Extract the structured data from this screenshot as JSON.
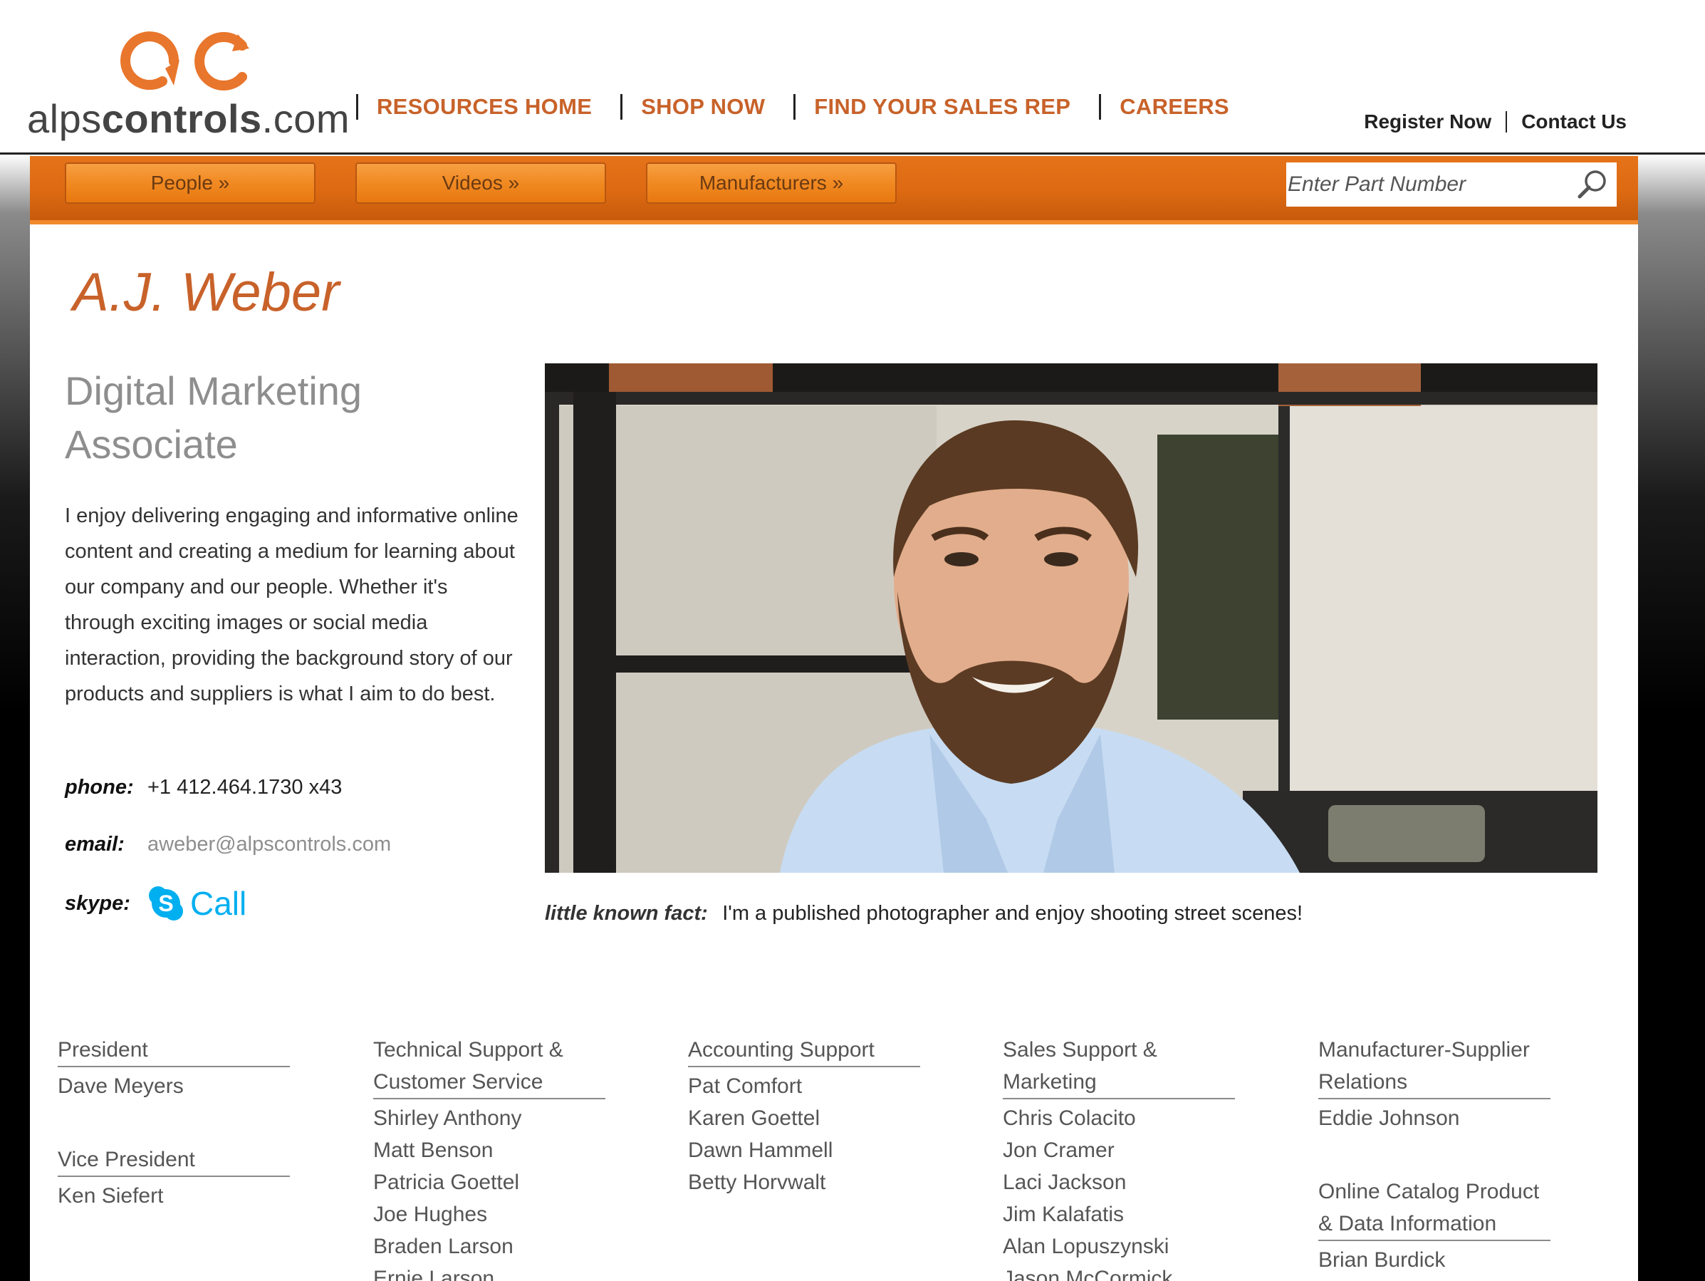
{
  "logo": {
    "text_light": "alps",
    "text_bold": "controls",
    "text_tail": ".com",
    "accent_color": "#e8762c"
  },
  "top_nav": [
    "RESOURCES HOME",
    "SHOP NOW",
    "FIND YOUR SALES REP",
    "CAREERS"
  ],
  "util_nav": {
    "register": "Register Now",
    "contact": "Contact Us"
  },
  "sub_nav": [
    "People »",
    "Videos »",
    "Manufacturers »"
  ],
  "search": {
    "placeholder": "Enter Part Number",
    "icon": "magnifier-icon"
  },
  "profile": {
    "name": "A.J. Weber",
    "title": "Digital Marketing Associate",
    "bio": "I enjoy delivering engaging and informative online content and creating a medium for learning about our company and our people. Whether it's through exciting images or social media interaction, providing the background story of our products and suppliers is what I aim to do best.",
    "phone_label": "phone:",
    "phone": "+1 412.464.1730 x43",
    "email_label": "email:",
    "email": "aweber@alpscontrols.com",
    "skype_label": "skype:",
    "skype_call": "Call",
    "fact_label": "little known fact:",
    "fact": "I'm a published photographer and enjoy shooting street scenes!"
  },
  "colors": {
    "accent": "#c8622a",
    "nav_orange": "#e8780f",
    "skype_blue": "#00aff0"
  },
  "directory": [
    [
      {
        "heading": "President",
        "members": [
          "Dave Meyers"
        ]
      },
      {
        "heading": "Vice President",
        "members": [
          "Ken Siefert"
        ]
      }
    ],
    [
      {
        "heading": "Technical Support & Customer Service",
        "members": [
          "Shirley Anthony",
          "Matt Benson",
          "Patricia Goettel",
          "Joe Hughes",
          "Braden Larson",
          "Ernie Larson"
        ]
      }
    ],
    [
      {
        "heading": "Accounting Support",
        "members": [
          "Pat Comfort",
          "Karen Goettel",
          "Dawn Hammell",
          "Betty Horvwalt"
        ]
      }
    ],
    [
      {
        "heading": "Sales Support & Marketing",
        "members": [
          "Chris Colacito",
          "Jon Cramer",
          "Laci Jackson",
          "Jim Kalafatis",
          "Alan Lopuszynski",
          "Jason McCormick"
        ]
      }
    ],
    [
      {
        "heading": "Manufacturer-Supplier Relations",
        "members": [
          "Eddie Johnson"
        ]
      },
      {
        "heading": "Online Catalog Product & Data Information",
        "members": [
          "Brian Burdick"
        ]
      }
    ]
  ]
}
